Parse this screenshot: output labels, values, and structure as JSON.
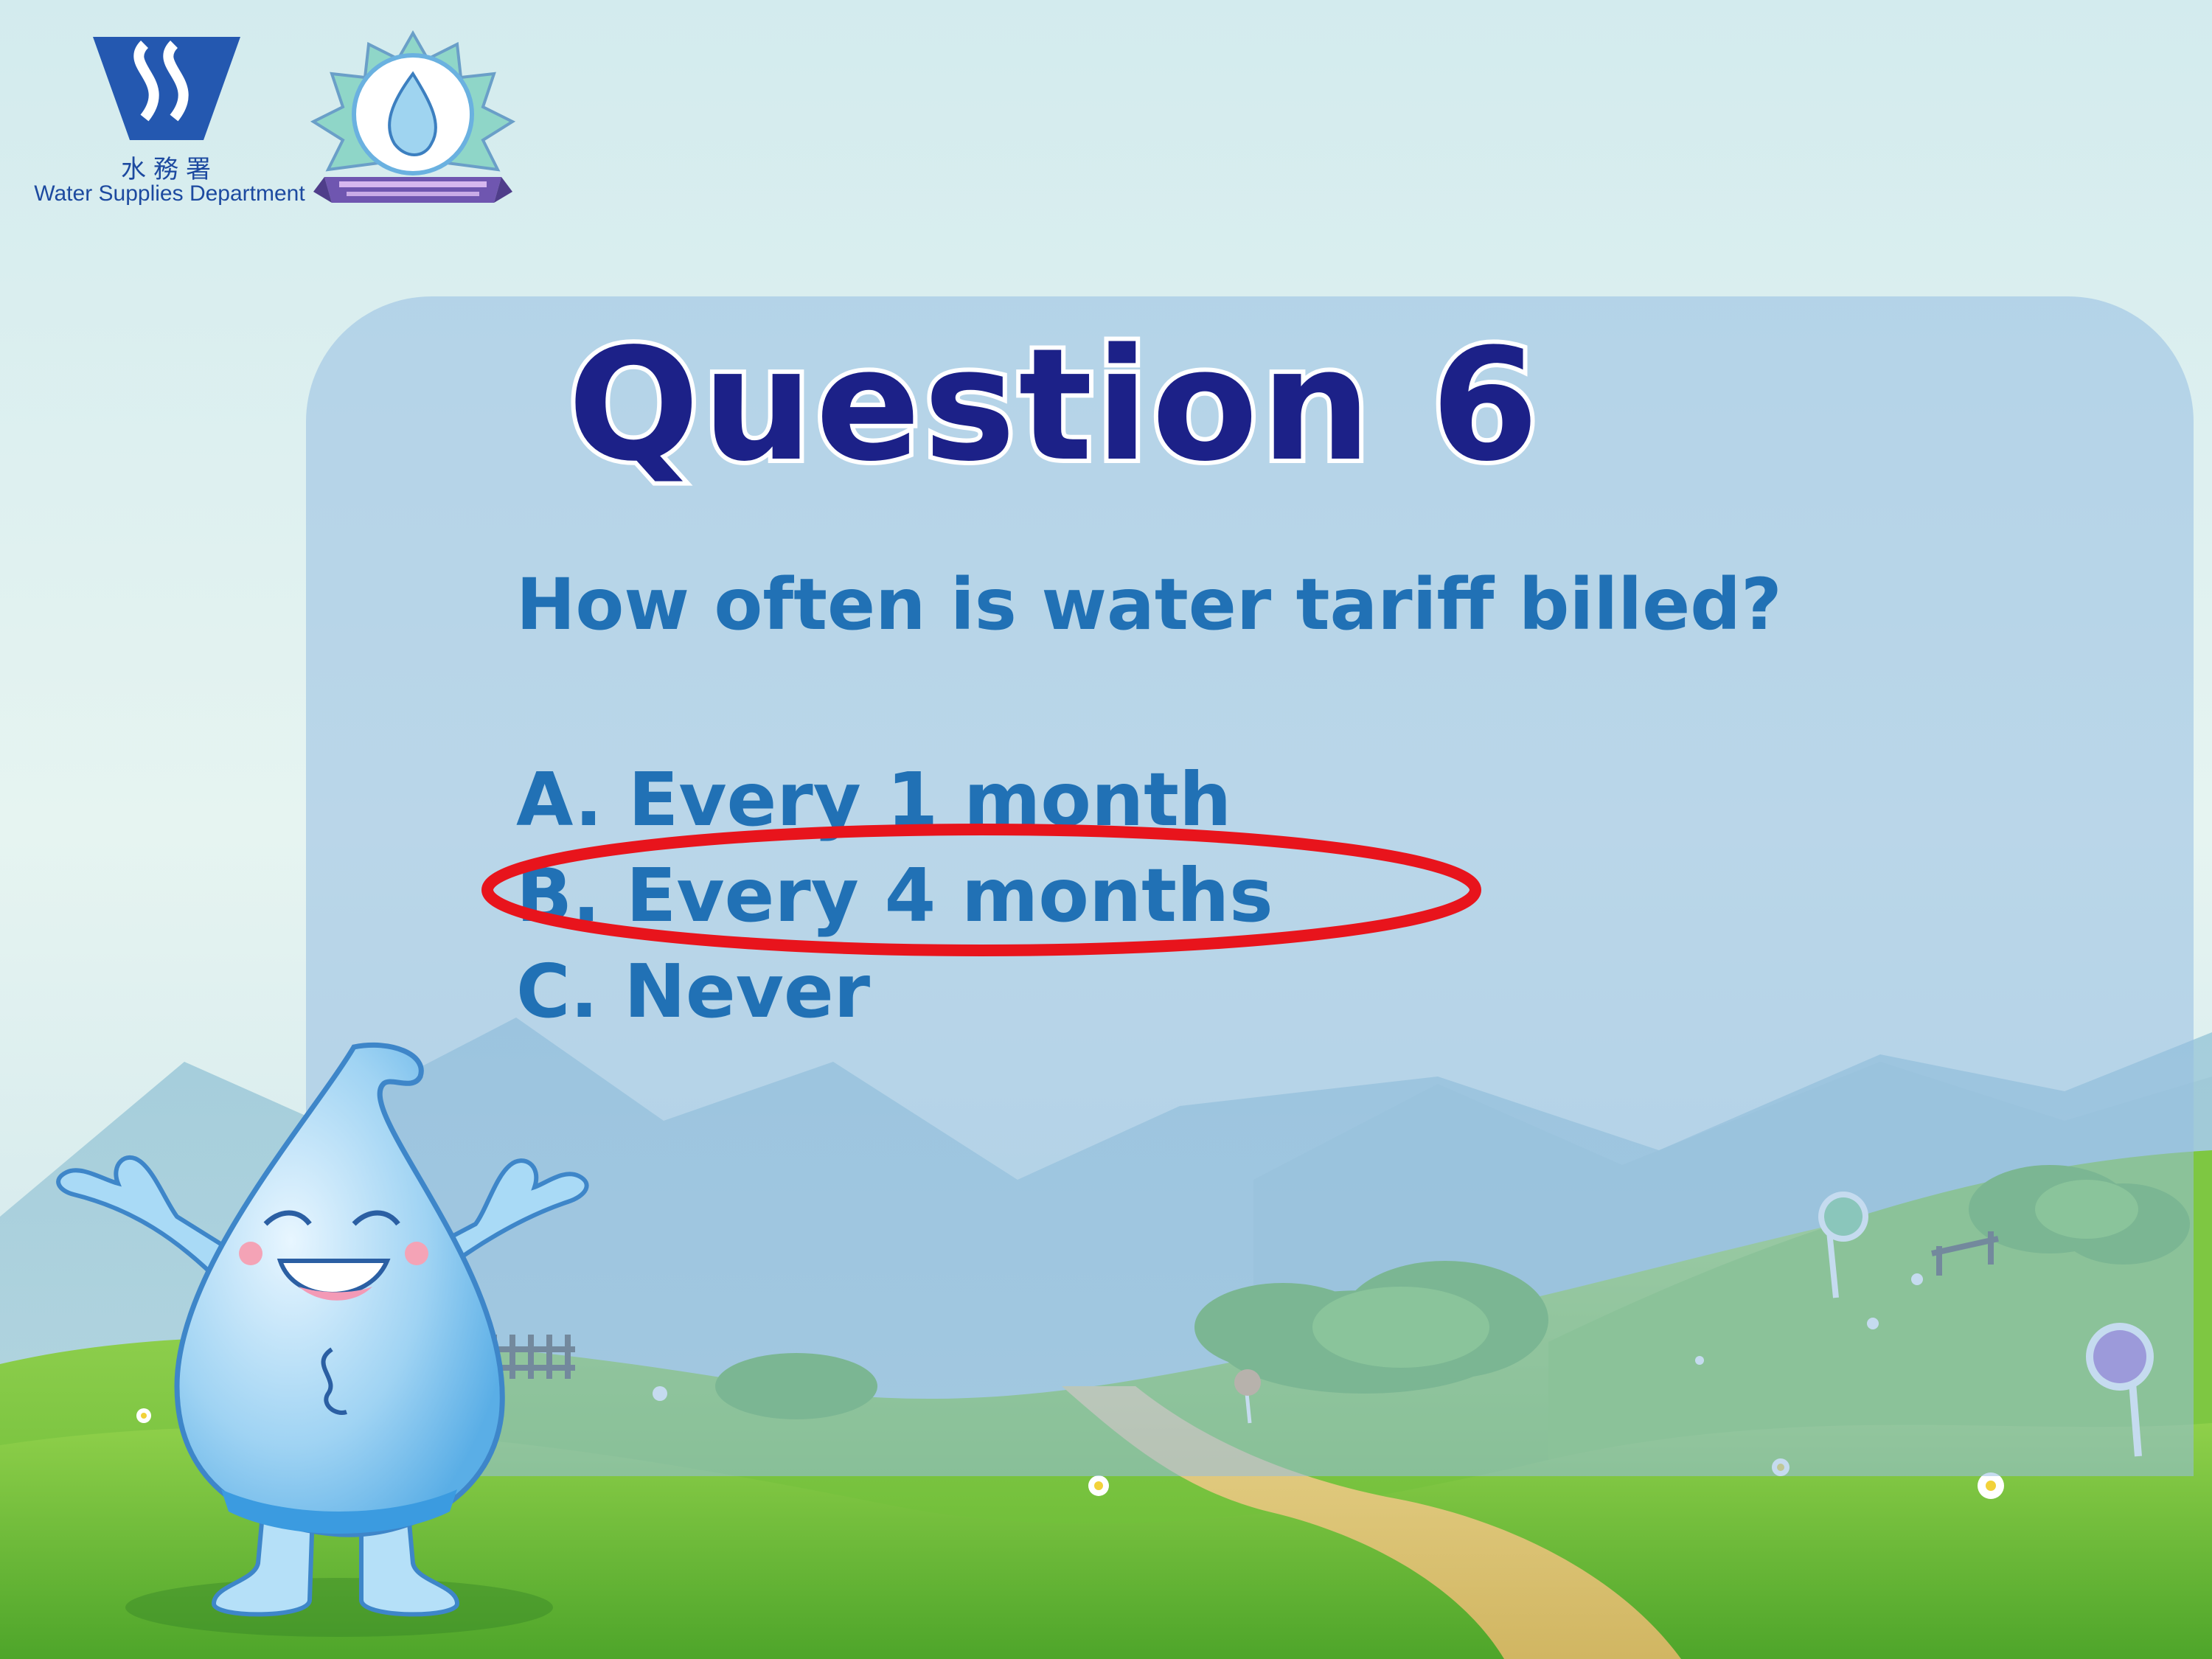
{
  "logo": {
    "org_name_cn": "水務署",
    "org_name_en": "Water Supplies Department"
  },
  "slide": {
    "title": "Question 6",
    "question": "How often is water tariff billed?",
    "options": [
      {
        "label": "A. Every 1 month",
        "selected": false
      },
      {
        "label": "B. Every 4 months",
        "selected": true
      },
      {
        "label": "C. Never",
        "selected": false
      }
    ]
  },
  "colors": {
    "title": "#1c2188",
    "text": "#2171b5",
    "highlight": "#e8141c",
    "sky": "#d6ecf0",
    "grass": "#6fbf3a"
  },
  "icons": {
    "highlight": "red-ellipse-icon",
    "mascot": "water-drop-mascot-icon"
  }
}
